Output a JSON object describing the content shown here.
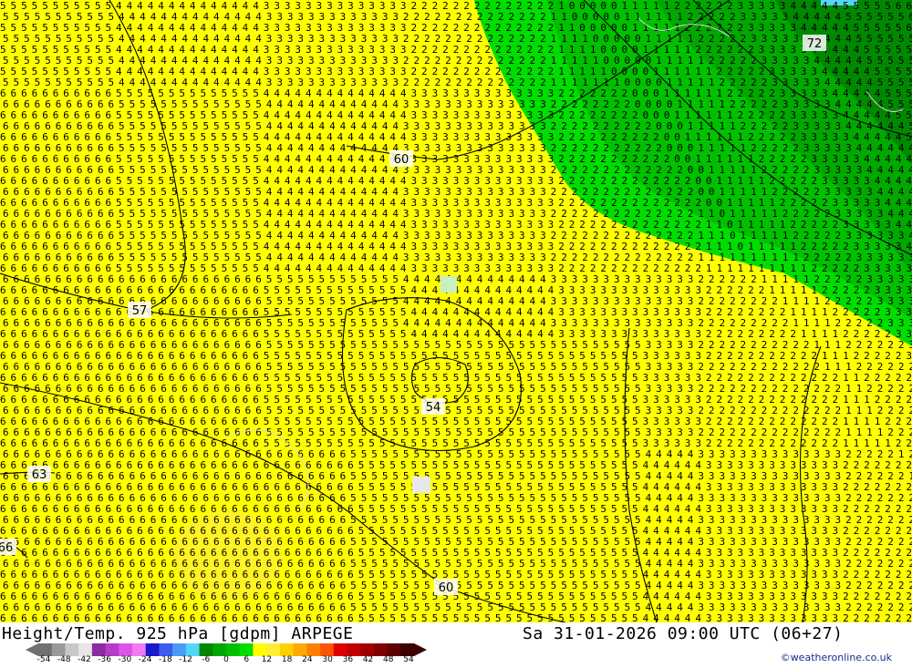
{
  "map": {
    "contour_labels": [
      "72",
      "60",
      "57",
      "54",
      "63",
      "66",
      "60"
    ],
    "colors": {
      "yellow": "#ffff00",
      "yellow_light": "#ffff66",
      "yellow_warm": "#ffee33",
      "green_light": "#00dd00",
      "green_mid": "#00c000",
      "green_dark": "#008800",
      "contour": "#000000",
      "coast": "#cccccc"
    }
  },
  "footer": {
    "title_left": "Height/Temp. 925 hPa [gdpm] ARPEGE",
    "title_right": "Sa 31-01-2026 09:00 UTC (06+27)",
    "credit": "©weatheronline.co.uk"
  },
  "scale": {
    "ticks": [
      "-54",
      "-48",
      "-42",
      "-36",
      "-30",
      "-24",
      "-18",
      "-12",
      "-6",
      "0",
      "6",
      "12",
      "18",
      "24",
      "30",
      "36",
      "42",
      "48",
      "54"
    ],
    "colors": [
      "#707070",
      "#999999",
      "#c8c8c8",
      "#e6e6e6",
      "#8c2aa0",
      "#b83ac8",
      "#dd55e8",
      "#f07cf4",
      "#1a1acd",
      "#3c5cf0",
      "#4a9cf5",
      "#55d5f5",
      "#008800",
      "#00a800",
      "#00c000",
      "#00dd00",
      "#ffff00",
      "#ffee33",
      "#ffd000",
      "#ffaa00",
      "#ff8000",
      "#ff5500",
      "#e00000",
      "#c00000",
      "#a00000",
      "#800000",
      "#5c0000",
      "#3c0000"
    ]
  }
}
